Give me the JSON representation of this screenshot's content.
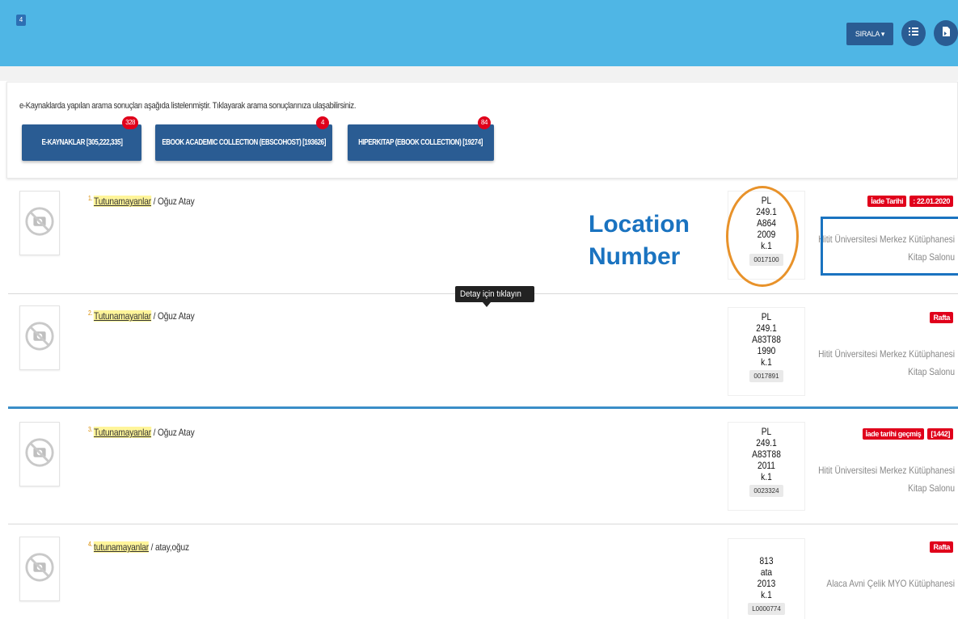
{
  "header": {
    "count": "4",
    "sort_label": "SIRALA ▾",
    "list_icon": "list-icon",
    "export_icon": "document-export-icon",
    "color": "#4fb6e5",
    "button_color": "#2a5c93"
  },
  "ekaynak": {
    "info": "e-Kaynaklarda yapılan arama sonuçları aşağıda listelenmiştir. Tıklayarak arama sonuçlarınıza ulaşabilirsiniz.",
    "buttons": [
      {
        "label": "E-KAYNAKLAR [305,222,335]",
        "badge": "328"
      },
      {
        "label": "EBOOK ACADEMIC COLLECTION (EBSCOHOST) [193626]",
        "badge": "4"
      },
      {
        "label": "HIPERKITAP (EBOOK COLLECTION) [19274]",
        "badge": "84"
      }
    ]
  },
  "results": [
    {
      "num": "1.",
      "title": "Tutunamayanlar",
      "author": " / Oğuz Atay",
      "call": [
        "PL",
        "249.1",
        "A864",
        "2009",
        "k.1"
      ],
      "barcode": "0017100",
      "badges": [
        "İade Tarihi",
        ": 22.01.2020"
      ],
      "library": "Hitit Üniversitesi Merkez Kütüphanesi",
      "location": "Kitap Salonu"
    },
    {
      "num": "2.",
      "title": "Tutunamayanlar",
      "author": " / Oğuz Atay",
      "call": [
        "PL",
        "249.1",
        "A83T88",
        "1990",
        "k.1"
      ],
      "barcode": "0017891",
      "badges": [
        "Rafta"
      ],
      "library": "Hitit Üniversitesi Merkez Kütüphanesi",
      "location": "Kitap Salonu"
    },
    {
      "num": "3.",
      "title": "Tutunamayanlar",
      "author": " / Oğuz Atay",
      "call": [
        "PL",
        "249.1",
        "A83T88",
        "2011",
        "k.1"
      ],
      "barcode": "0023324",
      "badges": [
        "İade tarihi geçmiş",
        "[1442]"
      ],
      "library": "Hitit Üniversitesi Merkez Kütüphanesi",
      "location": "Kitap Salonu"
    },
    {
      "num": "4.",
      "title": "tutunamayanlar",
      "author": " / atay,oğuz",
      "call": [
        "813",
        "ata",
        "2013",
        "k.1"
      ],
      "barcode": "L0000774",
      "badges": [
        "Rafta"
      ],
      "library": "Alaca Avni Çelik MYO Kütüphanesi",
      "location": ""
    }
  ],
  "tooltip": "Detay için tıklayın",
  "annotation": {
    "line1": "Location",
    "line2": "Number",
    "oval_color": "#e8922a",
    "text_color": "#1a73c0"
  }
}
